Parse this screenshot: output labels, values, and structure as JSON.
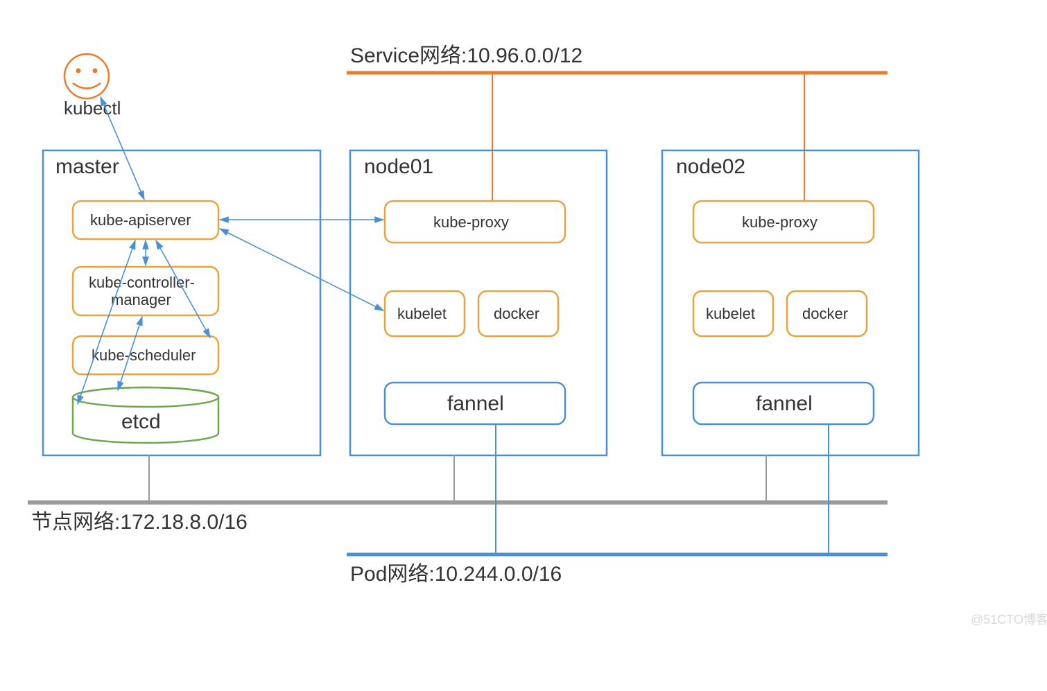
{
  "kubectl_label": "kubectl",
  "service_net_label": "Service网络:10.96.0.0/12",
  "node_net_label": "节点网络:172.18.8.0/16",
  "pod_net_label": "Pod网络:10.244.0.0/16",
  "master": {
    "title": "master",
    "apiserver": "kube-apiserver",
    "controller_line1": "kube-controller-",
    "controller_line2": "manager",
    "scheduler": "kube-scheduler",
    "etcd": "etcd"
  },
  "node01": {
    "title": "node01",
    "proxy": "kube-proxy",
    "kubelet": "kubelet",
    "docker": "docker",
    "flannel": "fannel"
  },
  "node02": {
    "title": "node02",
    "proxy": "kube-proxy",
    "kubelet": "kubelet",
    "docker": "docker",
    "flannel": "fannel"
  },
  "watermark": "@51CTO博客",
  "colors": {
    "blue": "#4A90D9",
    "orange_border": "#E8A33D",
    "orange_line": "#E87B2F",
    "green": "#6FA84F",
    "gray": "#9B9B9B",
    "arrow_blue": "#4A90D9"
  }
}
